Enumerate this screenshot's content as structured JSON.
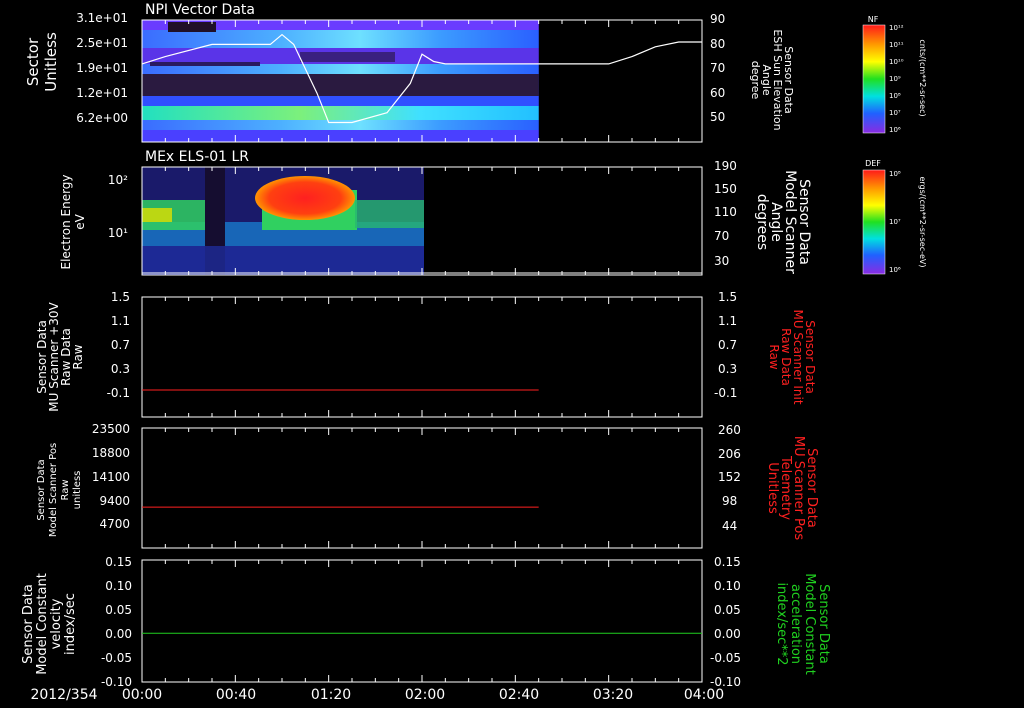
{
  "date_label": "2012/354",
  "x_ticks": [
    "00:00",
    "00:40",
    "01:20",
    "02:00",
    "02:40",
    "03:20",
    "04:00"
  ],
  "chart_data": [
    {
      "id": "npi",
      "type": "heatmap",
      "title": "NPI Vector Data",
      "ylabel": [
        "Sector",
        "Unitless"
      ],
      "yticks": [
        "3.1e+01",
        "2.5e+01",
        "1.9e+01",
        "1.2e+01",
        "6.2e+00"
      ],
      "right_ylabel": [
        "Sensor Data",
        "ESH Sun Elevation",
        "Angle",
        "degree"
      ],
      "right_yticks": [
        "90",
        "80",
        "70",
        "60",
        "50"
      ],
      "right_ylim": [
        40,
        90
      ],
      "data_end": "02:50",
      "line_series": {
        "x": [
          "00:00",
          "00:10",
          "00:30",
          "00:55",
          "01:00",
          "01:05",
          "01:15",
          "01:20",
          "01:30",
          "01:45",
          "01:55",
          "02:00",
          "02:05",
          "02:10",
          "02:30",
          "03:00",
          "03:20",
          "03:30",
          "03:40",
          "03:50",
          "04:00"
        ],
        "y": [
          72,
          75,
          80,
          80,
          84,
          80,
          60,
          48,
          48,
          52,
          64,
          76,
          73,
          72,
          72,
          72,
          72,
          75,
          79,
          81,
          81
        ]
      },
      "colorbar": {
        "label": "NF",
        "units": "cnts/(cm**2-sr-sec)",
        "ticks": [
          "10¹²",
          "10¹¹",
          "10¹⁰",
          "10⁹",
          "10⁸",
          "10⁷",
          "10⁶"
        ]
      }
    },
    {
      "id": "els",
      "type": "heatmap",
      "title": "MEx ELS-01 LR",
      "ylabel": [
        "Electron Energy",
        "eV"
      ],
      "yticks": [
        "10²",
        "10¹"
      ],
      "right_ylabel": [
        "Sensor Data",
        "Model Scanner",
        "Angle",
        "degrees"
      ],
      "right_yticks": [
        "190",
        "150",
        "110",
        "70",
        "30"
      ],
      "data_end": "02:00",
      "colorbar": {
        "label": "DEF",
        "units": "ergs/(cm**2-sr-sec-eV)",
        "ticks": [
          "10⁸",
          "10⁷",
          "10⁶"
        ]
      }
    },
    {
      "id": "mu30",
      "type": "line",
      "ylabel": [
        "Sensor Data",
        "MU Scanner +30V",
        "Raw Data",
        "Raw"
      ],
      "yticks": [
        "1.5",
        "1.1",
        "0.7",
        "0.3",
        "-0.1"
      ],
      "ylim": [
        -0.5,
        1.5
      ],
      "right_ylabel": [
        "Sensor Data",
        "MU Scanner Init",
        "Raw Data",
        "Raw"
      ],
      "right_yticks": [
        "1.5",
        "1.1",
        "0.7",
        "0.3",
        "-0.1"
      ],
      "series": [
        {
          "x": [
            "00:00",
            "02:50"
          ],
          "y": [
            -0.05,
            -0.05
          ]
        }
      ],
      "line_color": "#ff2020",
      "right_color": "#ff2020"
    },
    {
      "id": "mupos",
      "type": "line",
      "ylabel": [
        "Sensor Data",
        "Model Scanner Pos",
        "Raw",
        "unitless"
      ],
      "yticks": [
        "23500",
        "18800",
        "14100",
        "9400",
        "4700"
      ],
      "ylim": [
        0,
        23500
      ],
      "right_ylabel": [
        "Sensor Data",
        "MU Scanner Pos",
        "Telemetry",
        "Unitless"
      ],
      "right_yticks": [
        "260",
        "206",
        "152",
        "98",
        "44"
      ],
      "series": [
        {
          "x": [
            "00:00",
            "02:50"
          ],
          "y": [
            8000,
            8000
          ]
        }
      ],
      "line_color": "#ff2020",
      "right_color": "#ff2020"
    },
    {
      "id": "const",
      "type": "line",
      "ylabel": [
        "Sensor Data",
        "Model Constant",
        "velocity",
        "index/sec"
      ],
      "yticks": [
        "0.15",
        "0.10",
        "0.05",
        "0.00",
        "-0.05",
        "-0.10"
      ],
      "ylim": [
        -0.1,
        0.15
      ],
      "right_ylabel": [
        "Sensor Data",
        "Model Constant",
        "acceleration",
        "index/sec**2"
      ],
      "right_yticks": [
        "0.15",
        "0.10",
        "0.05",
        "0.00",
        "-0.05",
        "-0.10"
      ],
      "series": [
        {
          "x": [
            "00:00",
            "04:00"
          ],
          "y": [
            0,
            0
          ]
        }
      ],
      "line_color": "#20d020",
      "right_color": "#20d020"
    }
  ]
}
